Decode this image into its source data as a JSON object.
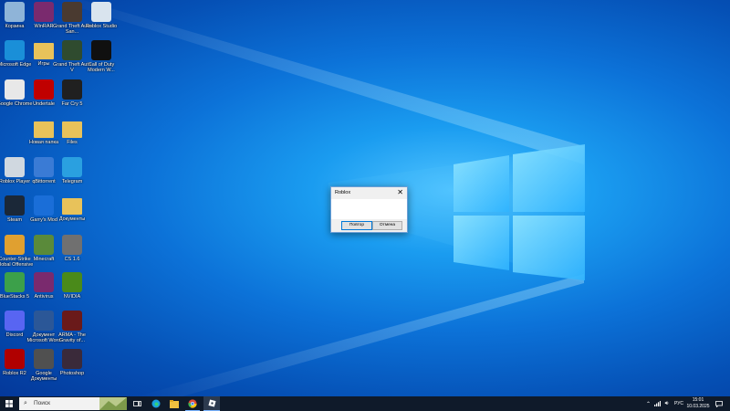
{
  "desktop_icons": [
    {
      "label": "Корзина",
      "icon": "recycle-bin-icon",
      "color": "#8fb4d8"
    },
    {
      "label": "WinRAR",
      "icon": "winrar-icon",
      "color": "#7a2a6e"
    },
    {
      "label": "Grand Theft Auto San...",
      "icon": "gta-sa-icon",
      "color": "#4a3a30"
    },
    {
      "label": "Roblox Studio",
      "icon": "roblox-studio-icon",
      "color": "#d9e4ee"
    },
    {
      "label": "Microsoft Edge",
      "icon": "edge-icon",
      "color": "#1a8fd8"
    },
    {
      "label": "Игры",
      "icon": "folder-icon",
      "color": "#e8c25a"
    },
    {
      "label": "Grand Theft Auto V",
      "icon": "gta-v-icon",
      "color": "#2f4b2f"
    },
    {
      "label": "Call of Duty Modern W...",
      "icon": "modern-warfare-icon",
      "color": "#101010"
    },
    {
      "label": "Google Chrome",
      "icon": "chrome-icon",
      "color": "#e8e8e8"
    },
    {
      "label": "Undertale",
      "icon": "undertale-icon",
      "color": "#c00000"
    },
    {
      "label": "Far Cry 5",
      "icon": "far-cry-5-icon",
      "color": "#202020"
    },
    {
      "label": "Новая папка",
      "icon": "folder-icon",
      "color": "#e8c25a"
    },
    {
      "label": "Files",
      "icon": "folder-icon",
      "color": "#e8c25a"
    },
    {
      "label": "Roblox Player",
      "icon": "roblox-player-icon",
      "color": "#d0d8e0"
    },
    {
      "label": "qBittorrent",
      "icon": "qbittorrent-icon",
      "color": "#3a7bd5"
    },
    {
      "label": "Telegram",
      "icon": "telegram-icon",
      "color": "#2aa0e0"
    },
    {
      "label": "Steam",
      "icon": "steam-icon",
      "color": "#1b2838"
    },
    {
      "label": "Garry's Mod",
      "icon": "garrys-mod-icon",
      "color": "#1a6ed8"
    },
    {
      "label": "Документы",
      "icon": "folder-icon",
      "color": "#e8c25a"
    },
    {
      "label": "Counter-Strike Global Offensive",
      "icon": "csgo-icon",
      "color": "#e0a030"
    },
    {
      "label": "Minecraft",
      "icon": "minecraft-icon",
      "color": "#5a8a3a"
    },
    {
      "label": "CS 1.6",
      "icon": "cs16-icon",
      "color": "#707070"
    },
    {
      "label": "BlueStacks 5",
      "icon": "bluestacks-icon",
      "color": "#3ca04a"
    },
    {
      "label": "Antivirus",
      "icon": "winrar-icon",
      "color": "#7a2a6e"
    },
    {
      "label": "NVIDIA",
      "icon": "nvidia-icon",
      "color": "#4a8a1a"
    },
    {
      "label": "Discord",
      "icon": "discord-icon",
      "color": "#5865f2"
    },
    {
      "label": "Документ Microsoft Word",
      "icon": "word-icon",
      "color": "#2b5797"
    },
    {
      "label": "ARMA - The Gravity of...",
      "icon": "game-icon",
      "color": "#6a1a1a"
    },
    {
      "label": "Roblox R2",
      "icon": "r2-icon",
      "color": "#b00000"
    },
    {
      "label": "Google Документы",
      "icon": "docs-icon",
      "color": "#505050"
    },
    {
      "label": "Photoshop",
      "icon": "photoshop-icon",
      "color": "#3a2a3a"
    }
  ],
  "dialog": {
    "title": "Roblox",
    "retry_label": "Повтор",
    "cancel_label": "Отмена",
    "close_glyph": "✕"
  },
  "taskbar": {
    "search_placeholder": "Поиск",
    "language": "РУС",
    "time": "15:01",
    "date": "10.03.2025"
  },
  "colors": {
    "taskbar": "#0f1a2a",
    "accent": "#0078d7"
  }
}
